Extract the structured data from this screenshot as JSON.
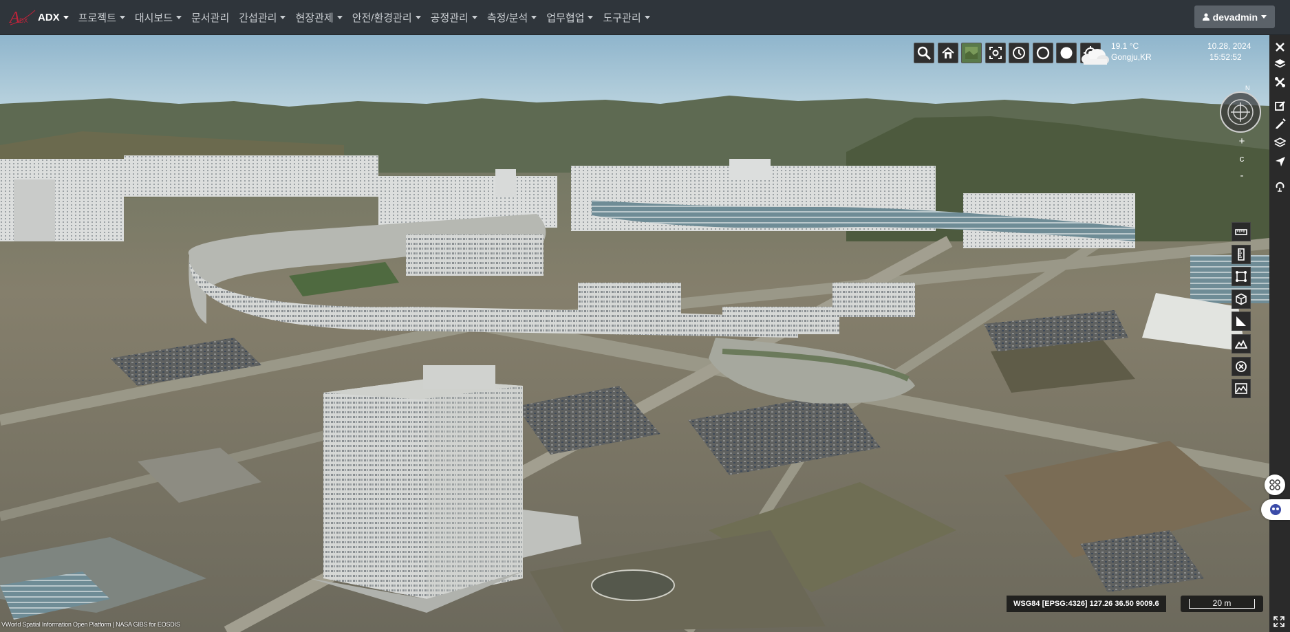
{
  "app": {
    "brand_name": "ADX",
    "brand_logo_text": "ADX"
  },
  "nav": {
    "items": [
      {
        "label": "프로젝트",
        "dropdown": true
      },
      {
        "label": "대시보드",
        "dropdown": true
      },
      {
        "label": "문서관리",
        "dropdown": false
      },
      {
        "label": "간섭관리",
        "dropdown": true
      },
      {
        "label": "현장관제",
        "dropdown": true
      },
      {
        "label": "안전/환경관리",
        "dropdown": true
      },
      {
        "label": "공정관리",
        "dropdown": true
      },
      {
        "label": "측정/분석",
        "dropdown": true
      },
      {
        "label": "업무협업",
        "dropdown": true
      },
      {
        "label": "도구관리",
        "dropdown": true
      }
    ],
    "user": "devadmin",
    "user_icon": "user-icon"
  },
  "map_toolbar": {
    "tools": [
      "search-icon",
      "home-icon",
      "satellite-layer-icon",
      "screen-capture-icon",
      "history-clock-icon",
      "circle-outline-icon",
      "circle-filled-icon",
      "locate-target-icon"
    ]
  },
  "weather": {
    "temperature": "19.1 °C",
    "location": "Gongju,KR",
    "date": "10.28, 2024",
    "time": "15:52:52",
    "icon": "cloud-icon"
  },
  "compass": {
    "north_label": "N"
  },
  "zoom": {
    "in_label": "+",
    "reset_label": "c",
    "out_label": "-"
  },
  "right_rail": {
    "items": [
      "close-icon",
      "layers-icon",
      "tools-cross-icon",
      "edit-icon",
      "pen-icon",
      "stack-icon",
      "send-icon",
      "undo-icon"
    ]
  },
  "side_tools": {
    "items": [
      "ruler-icon",
      "ruler-vertical-icon",
      "area-measure-icon",
      "cube-icon",
      "angle-icon",
      "terrain-icon",
      "clear-icon",
      "profile-icon"
    ]
  },
  "floating": {
    "items": [
      "grid-apps-icon",
      "chatbot-icon"
    ]
  },
  "coordinates": {
    "text": "WSG84 [EPSG:4326] 127.26 36.50 9009.6"
  },
  "scale": {
    "label": "20 m"
  },
  "attribution": {
    "text": "VWorld Spatial Information Open Platform | NASA GIBS for EOSDIS"
  },
  "colors": {
    "navbar_bg": "#2f353b",
    "nav_text": "#c9cdd1",
    "user_button": "#5b6269",
    "map_sky": "#a9c9d8",
    "map_ground": "#7d7a6a"
  }
}
